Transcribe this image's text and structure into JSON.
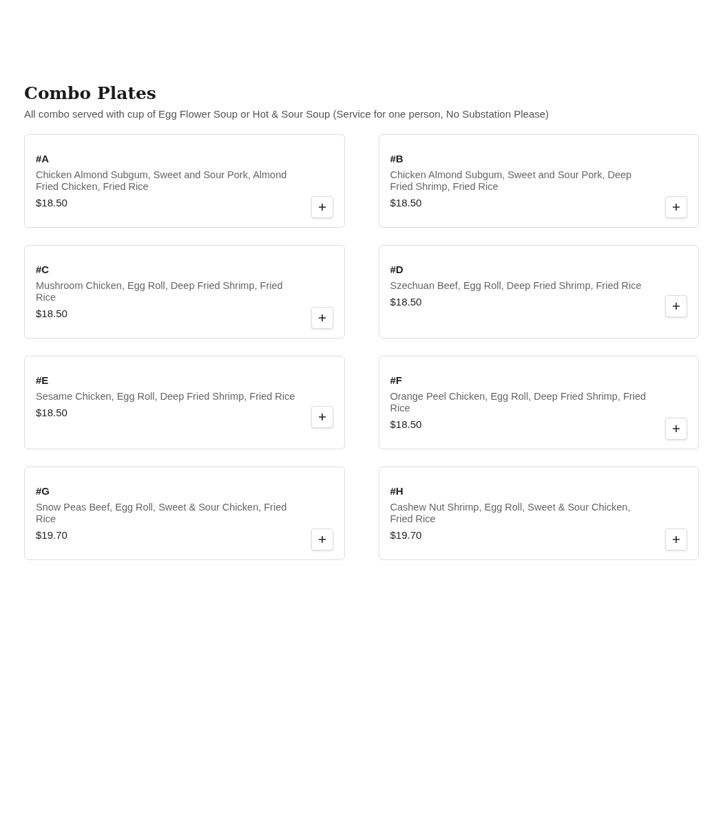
{
  "section": {
    "title": "Combo Plates",
    "subtitle": "All combo served with cup of Egg Flower Soup or Hot & Sour Soup (Service for one person, No Substation Please)"
  },
  "items": [
    {
      "name": "#A",
      "description": "Chicken Almond Subgum, Sweet and Sour Pork, Almond Fried Chicken, Fried Rice",
      "price": "$18.50"
    },
    {
      "name": "#B",
      "description": "Chicken Almond Subgum, Sweet and Sour Pork, Deep Fried Shrimp, Fried Rice",
      "price": "$18.50"
    },
    {
      "name": "#C",
      "description": "Mushroom Chicken, Egg Roll, Deep Fried Shrimp, Fried Rice",
      "price": "$18.50"
    },
    {
      "name": "#D",
      "description": "Szechuan Beef, Egg Roll, Deep Fried Shrimp, Fried Rice",
      "price": "$18.50"
    },
    {
      "name": "#E",
      "description": "Sesame Chicken, Egg Roll, Deep Fried Shrimp, Fried Rice",
      "price": "$18.50"
    },
    {
      "name": "#F",
      "description": "Orange Peel Chicken, Egg Roll, Deep Fried Shrimp, Fried Rice",
      "price": "$18.50"
    },
    {
      "name": "#G",
      "description": "Snow Peas Beef, Egg Roll, Sweet & Sour Chicken, Fried Rice",
      "price": "$19.70"
    },
    {
      "name": "#H",
      "description": "Cashew Nut Shrimp, Egg Roll, Sweet & Sour Chicken, Fried Rice",
      "price": "$19.70"
    }
  ]
}
